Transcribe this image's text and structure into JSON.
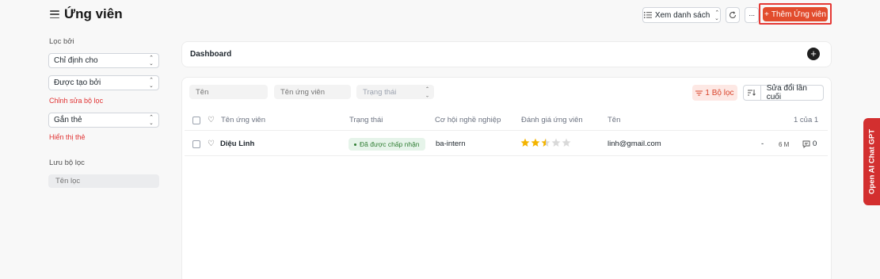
{
  "header": {
    "title": "Ứng viên",
    "view_label": "Xem danh sách",
    "more_label": "···",
    "add_label": "Thêm Ứng viên",
    "add_prefix": "+"
  },
  "sidebar": {
    "filter_heading": "Lọc bởi",
    "assigned_to": "Chỉ định cho",
    "created_by": "Được tạo bởi",
    "edit_filters_link": "Chỉnh sửa bộ lọc",
    "tags": "Gắn thẻ",
    "show_tags_link": "Hiển thị thẻ",
    "save_filter_heading": "Lưu bộ lọc",
    "filter_name_placeholder": "Tên lọc"
  },
  "dashboard": {
    "title": "Dashboard",
    "add_label": "+"
  },
  "list": {
    "filters": {
      "name_placeholder": "Tên",
      "candidate_placeholder": "Tên ứng viên",
      "status_placeholder": "Trạng thái"
    },
    "filter_chip": "1 Bộ lọc",
    "sort_label": "Sửa đổi lần cuối",
    "columns": {
      "candidate": "Tên ứng viên",
      "status": "Trạng thái",
      "opportunity": "Cơ hội nghề nghiệp",
      "rating": "Đánh giá ứng viên",
      "name": "Tên"
    },
    "count": "1 của 1",
    "rows": [
      {
        "candidate": "Diệu Linh",
        "status": "Đã được chấp nhận",
        "opportunity": "ba-intern",
        "rating": 2.5,
        "rating_max": 5,
        "name": "linh@gmail.com",
        "dash": "-",
        "modified": "6 M",
        "comments": "0"
      }
    ]
  },
  "side_tab": {
    "label": "Open AI Chat GPT",
    "color": "#d32f2f"
  },
  "colors": {
    "accent": "#e24c2d",
    "highlight": "#e53935",
    "star_filled": "#f4b400",
    "star_empty": "#d9d9d9",
    "success": "#2e7d32"
  }
}
